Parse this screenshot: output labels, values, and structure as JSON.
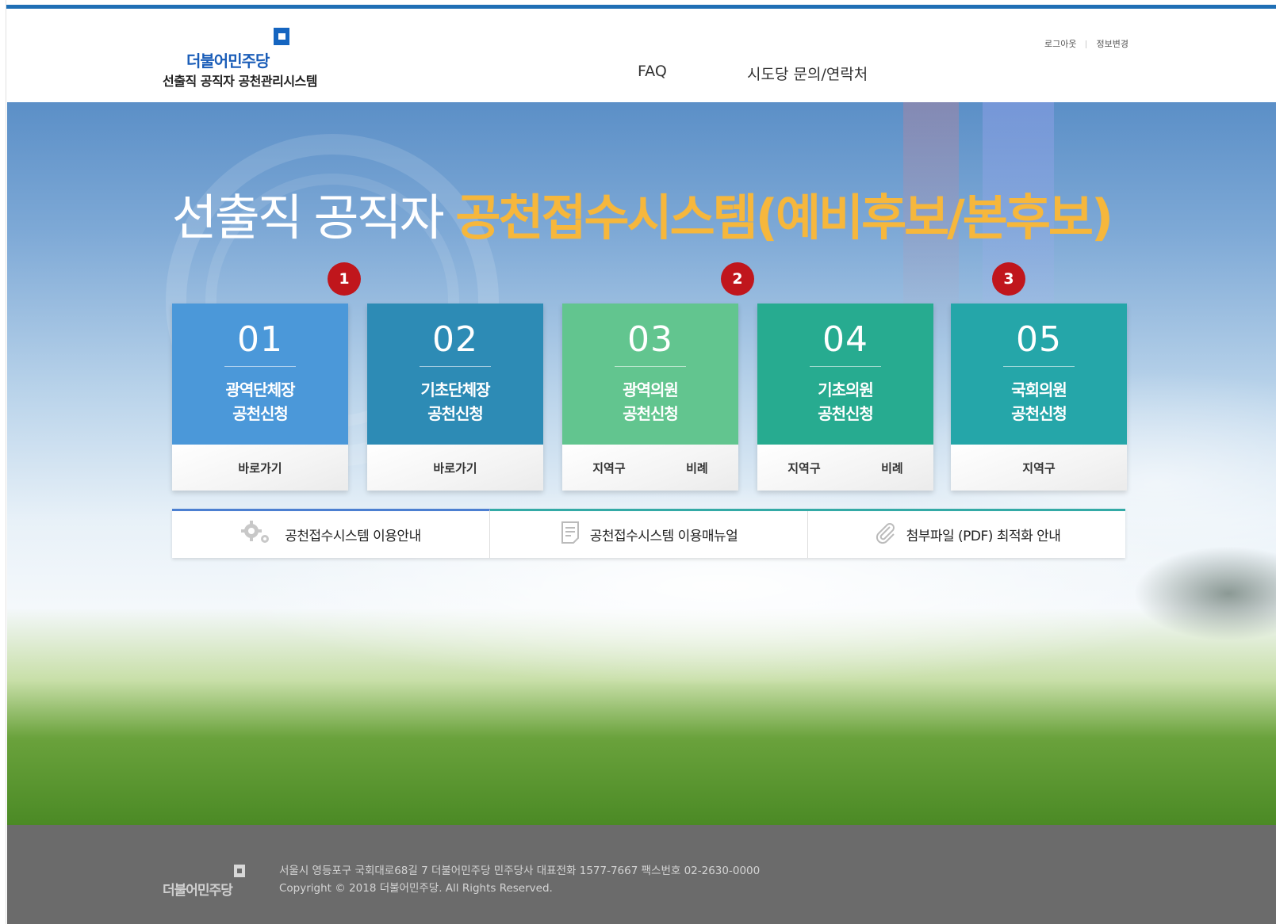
{
  "header": {
    "logo_brand": "더불어민주당",
    "logo_subtitle": "선출직 공직자 공천관리시스템",
    "nav": [
      "FAQ",
      "시도당 문의/연락처"
    ],
    "util": {
      "logout": "로그아웃",
      "edit_profile": "정보변경"
    }
  },
  "hero": {
    "title_white": "선출직 공직자 ",
    "title_accent": "공천접수시스템(예비후보/본후보)",
    "badges": [
      "1",
      "2",
      "3"
    ]
  },
  "cards": [
    {
      "num": "01",
      "name": "광역단체장\n공천신청",
      "links": [
        "바로가기"
      ]
    },
    {
      "num": "02",
      "name": "기초단체장\n공천신청",
      "links": [
        "바로가기"
      ]
    },
    {
      "num": "03",
      "name": "광역의원\n공천신청",
      "links": [
        "지역구",
        "비례"
      ]
    },
    {
      "num": "04",
      "name": "기초의원\n공천신청",
      "links": [
        "지역구",
        "비례"
      ]
    },
    {
      "num": "05",
      "name": "국회의원\n공천신청",
      "links": [
        "지역구"
      ]
    }
  ],
  "guide": [
    {
      "icon": "gear-icon",
      "label": "공천접수시스템 이용안내"
    },
    {
      "icon": "document-icon",
      "label": "공천접수시스템 이용매뉴얼"
    },
    {
      "icon": "paperclip-icon",
      "label": "첨부파일 (PDF) 최적화 안내"
    }
  ],
  "footer": {
    "brand": "더불어민주당",
    "address": "서울시 영등포구 국회대로68길 7 더불어민주당 민주당사 대표전화 1577-7667 팩스번호 02-2630-0000",
    "copyright": "Copyright © 2018 더불어민주당. All Rights Reserved."
  },
  "colors": {
    "brand_blue": "#1565c0",
    "accent_yellow": "#f6b73c",
    "badge_red": "#c0161c",
    "card1": "#4b98d9",
    "card2": "#2d8bb5",
    "card3": "#62c58f",
    "card4": "#27ab90",
    "card5": "#25a6a9",
    "footer_bg": "#6b6b6b"
  }
}
